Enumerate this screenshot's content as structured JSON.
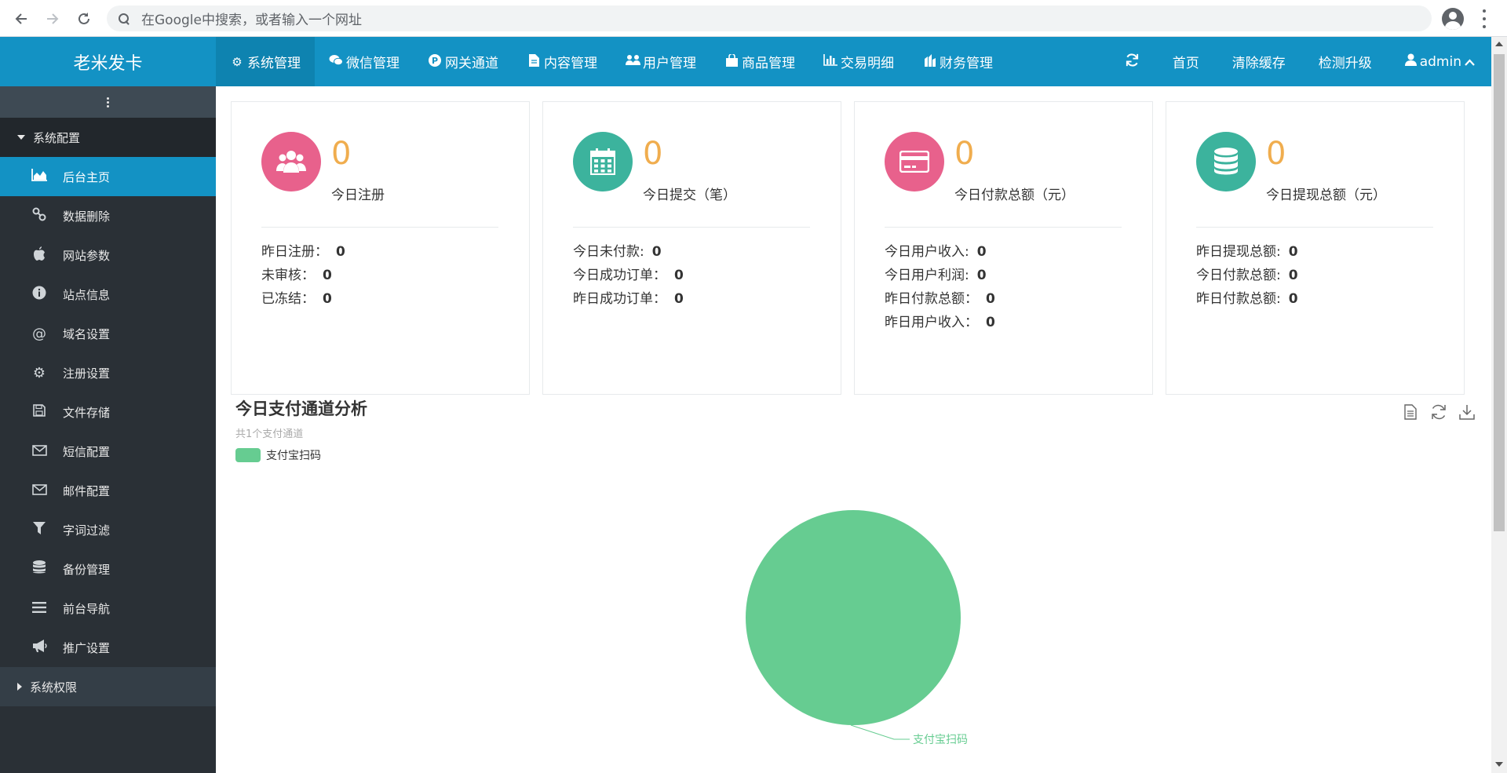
{
  "browser": {
    "omnibox_placeholder": "在Google中搜索，或者输入一个网址"
  },
  "header": {
    "brand": "老米发卡",
    "nav": [
      {
        "label": "系统管理",
        "icon": "gear-icon",
        "active": true
      },
      {
        "label": "微信管理",
        "icon": "wechat-icon"
      },
      {
        "label": "网关通道",
        "icon": "p-circle-icon"
      },
      {
        "label": "内容管理",
        "icon": "file-icon"
      },
      {
        "label": "用户管理",
        "icon": "users-icon"
      },
      {
        "label": "商品管理",
        "icon": "shopping-bag-icon"
      },
      {
        "label": "交易明细",
        "icon": "bar-chart-icon"
      },
      {
        "label": "财务管理",
        "icon": "finance-icon"
      }
    ],
    "right": {
      "refresh_icon": "refresh-icon",
      "home": "首页",
      "clear_cache": "清除缓存",
      "check_upgrade": "检测升级",
      "user": "admin"
    }
  },
  "sidebar": {
    "group_open": "系统配置",
    "items": [
      {
        "label": "后台主页",
        "icon": "area-chart-icon",
        "active": true
      },
      {
        "label": "数据删除",
        "icon": "link-icon"
      },
      {
        "label": "网站参数",
        "icon": "apple-icon"
      },
      {
        "label": "站点信息",
        "icon": "info-icon"
      },
      {
        "label": "域名设置",
        "icon": "at-icon"
      },
      {
        "label": "注册设置",
        "icon": "gear-icon"
      },
      {
        "label": "文件存储",
        "icon": "save-icon"
      },
      {
        "label": "短信配置",
        "icon": "envelope-icon"
      },
      {
        "label": "邮件配置",
        "icon": "envelope-icon"
      },
      {
        "label": "字词过滤",
        "icon": "filter-icon"
      },
      {
        "label": "备份管理",
        "icon": "database-icon"
      },
      {
        "label": "前台导航",
        "icon": "bars-icon"
      },
      {
        "label": "推广设置",
        "icon": "bullhorn-icon"
      }
    ],
    "group_collapsed": "系统权限"
  },
  "stats": [
    {
      "value": "0",
      "label": "今日注册",
      "color": "#e8618c",
      "icon": "users-icon",
      "lines": [
        {
          "label": "昨日注册：",
          "value": "0"
        },
        {
          "label": "未审核：",
          "value": "0"
        },
        {
          "label": "已冻结：",
          "value": "0"
        }
      ]
    },
    {
      "value": "0",
      "label": "今日提交（笔）",
      "color": "#3cb39d",
      "icon": "calendar-icon",
      "lines": [
        {
          "label": "今日未付款:",
          "value": "0"
        },
        {
          "label": "今日成功订单：",
          "value": "0"
        },
        {
          "label": "昨日成功订单：",
          "value": "0"
        }
      ]
    },
    {
      "value": "0",
      "label": "今日付款总额（元）",
      "color": "#e8618c",
      "icon": "credit-card-icon",
      "lines": [
        {
          "label": "今日用户收入:",
          "value": "0"
        },
        {
          "label": "今日用户利润:",
          "value": "0"
        },
        {
          "label": "昨日付款总额：",
          "value": "0"
        },
        {
          "label": "昨日用户收入：",
          "value": "0"
        }
      ]
    },
    {
      "value": "0",
      "label": "今日提现总额（元）",
      "color": "#3cb39d",
      "icon": "database-icon",
      "lines": [
        {
          "label": "昨日提现总额:",
          "value": "0"
        },
        {
          "label": "今日付款总额:",
          "value": "0"
        },
        {
          "label": "昨日付款总额:",
          "value": "0"
        }
      ]
    }
  ],
  "chart_data": {
    "type": "pie",
    "title": "今日支付通道分析",
    "subtitle": "共1个支付通道",
    "legend": [
      "支付宝扫码"
    ],
    "slices": [
      {
        "name": "支付宝扫码",
        "value": 1,
        "color": "#66cc91"
      }
    ],
    "legend_placement": "top-left"
  },
  "chart_tools": [
    "data-view-icon",
    "restore-icon",
    "save-image-icon"
  ]
}
